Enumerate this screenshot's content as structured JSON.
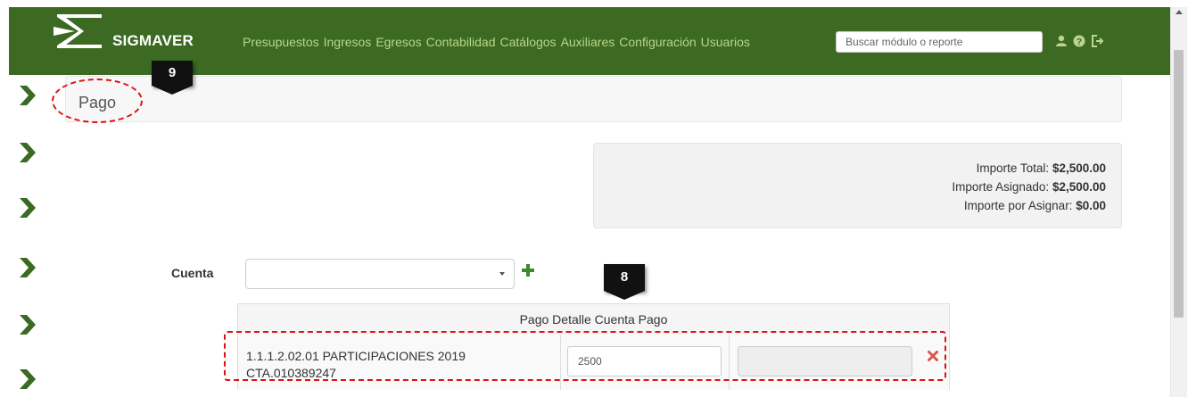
{
  "app": {
    "name": "SIGMAVER"
  },
  "navbar": {
    "menu": [
      "Presupuestos",
      "Ingresos",
      "Egresos",
      "Contabilidad",
      "Catálogos",
      "Auxiliares",
      "Configuración",
      "Usuarios"
    ],
    "search": {
      "placeholder": "Buscar módulo o reporte",
      "value": ""
    },
    "icons": [
      "user-icon",
      "help-icon",
      "logout-icon"
    ],
    "colors": {
      "background": "#3c6a22",
      "menu_text": "#b9d68a",
      "brand_text": "#ffffff"
    }
  },
  "sidebar": {
    "icons": [
      "chevron-right-icon",
      "chevron-right-icon",
      "chevron-right-icon",
      "chevron-right-icon",
      "chevron-right-icon",
      "chevron-right-icon"
    ],
    "color": "#3c6a22"
  },
  "page": {
    "title": "Pago"
  },
  "summary": {
    "total_label": "Importe Total:",
    "total_value": "$2,500.00",
    "assigned_label": "Importe Asignado:",
    "assigned_value": "$2,500.00",
    "pending_label": "Importe por Asignar:",
    "pending_value": "$0.00"
  },
  "form": {
    "cuenta_label": "Cuenta",
    "cuenta_value": ""
  },
  "detail": {
    "header": "Pago Detalle Cuenta Pago",
    "rows": [
      {
        "account_line1": "1.1.1.2.02.01 PARTICIPACIONES 2019",
        "account_line2": "CTA.010389247",
        "amount": "2500",
        "extra": ""
      }
    ]
  },
  "annotations": {
    "badge_9": "9",
    "badge_8": "8",
    "highlight_color": "#dd1111"
  }
}
